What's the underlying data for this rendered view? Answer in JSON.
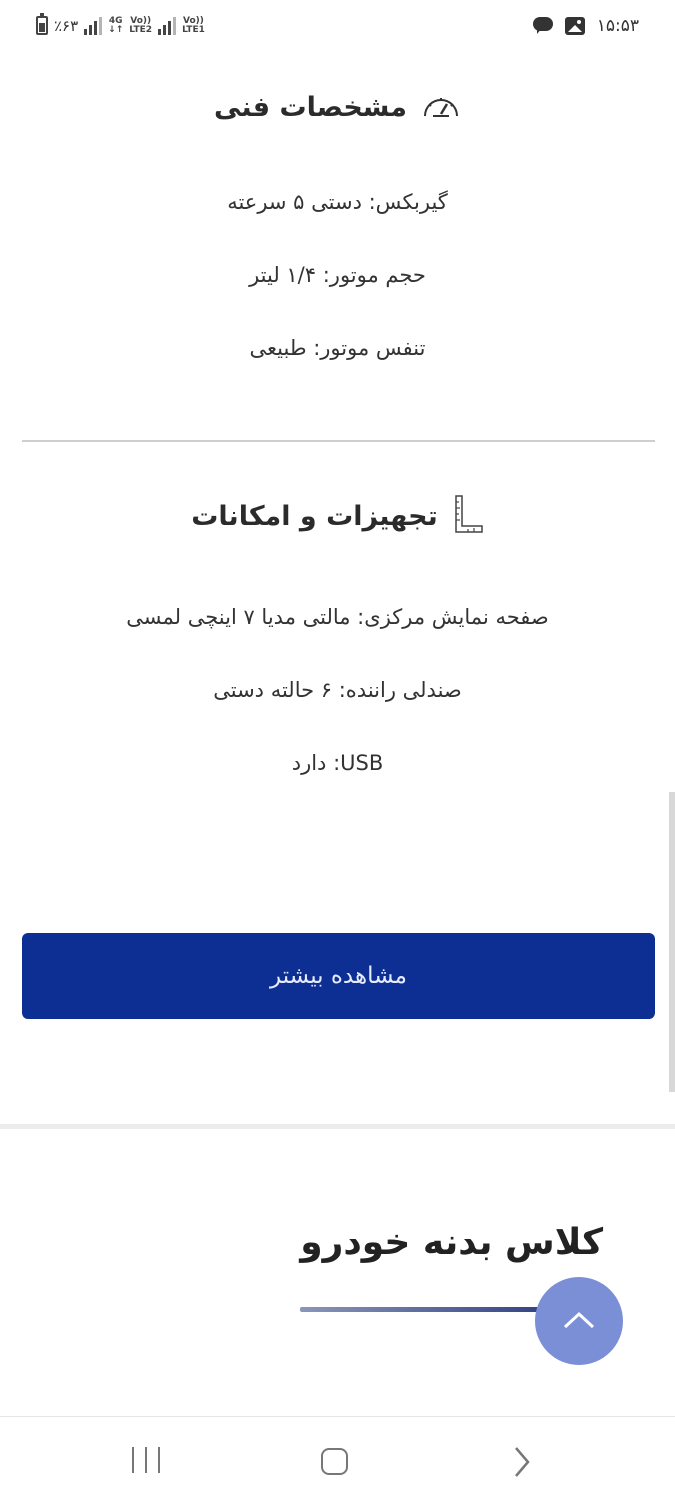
{
  "status_bar": {
    "battery_text": "٪۶۳",
    "network_4g": "4G",
    "lte2": "LTE2",
    "lte1": "LTE1",
    "volte": "Vo))",
    "time": "۱۵:۵۳"
  },
  "specs": {
    "title": "مشخصات فنی",
    "icon": "gauge-icon",
    "items": [
      "گیربکس: دستی ۵ سرعته",
      "حجم موتور: ۱/۴ لیتر",
      "تنفس موتور: طبیعی"
    ]
  },
  "features": {
    "title": "تجهیزات و امکانات",
    "icon": "ruler-icon",
    "items": [
      "صفحه نمایش مرکزی: مالتی مدیا ۷ اینچی لمسی",
      "صندلی راننده: ۶ حالته دستی",
      "USB: دارد"
    ]
  },
  "more_button_label": "مشاهده بیشتر",
  "body_class": {
    "title": "کلاس بدنه خودرو"
  },
  "colors": {
    "primary_button": "#0d2f93",
    "fab": "#7b8fd6"
  }
}
